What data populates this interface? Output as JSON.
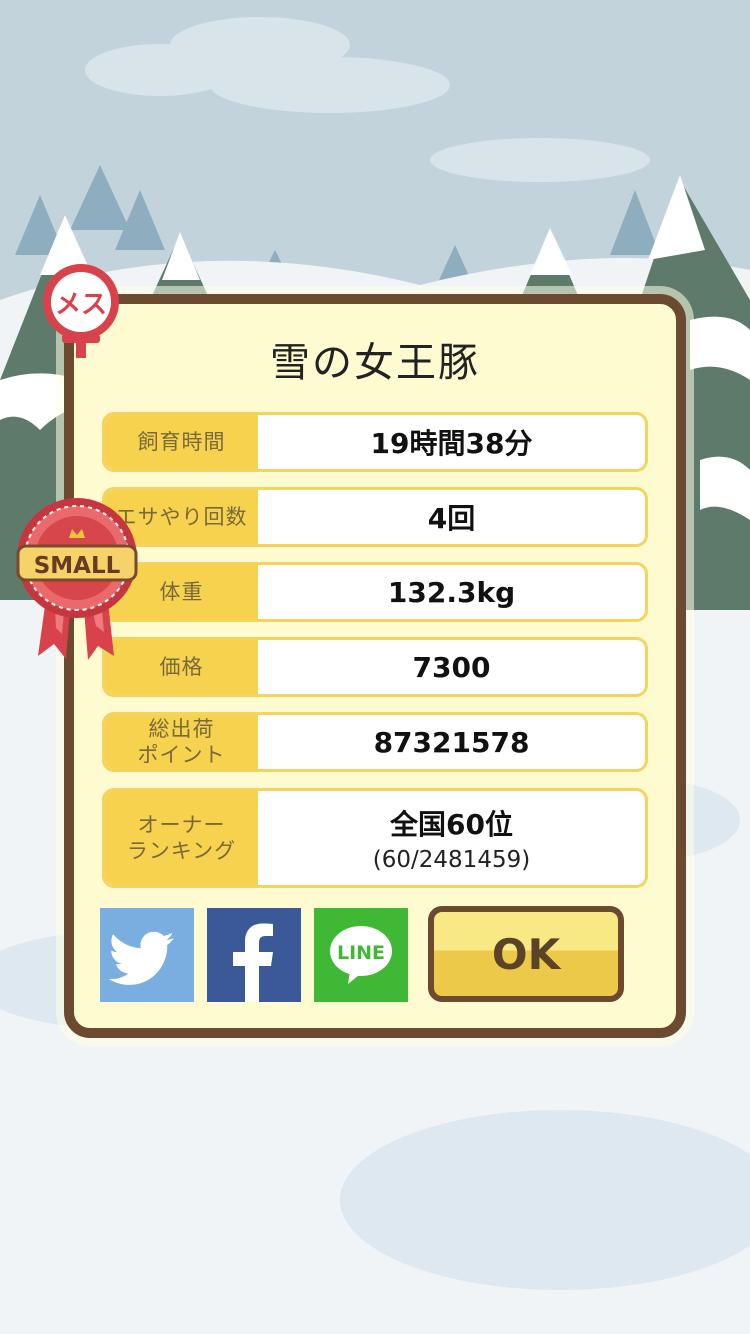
{
  "pig": {
    "name": "雪の女王豚",
    "gender_label": "メス",
    "size_badge": "SMALL"
  },
  "stats": [
    {
      "label": "飼育時間",
      "value": "19時間38分"
    },
    {
      "label": "エサやり回数",
      "value": "4回"
    },
    {
      "label": "体重",
      "value": "132.3kg"
    },
    {
      "label": "価格",
      "value": "7300"
    },
    {
      "label": "総出荷\nポイント",
      "value": "87321578"
    },
    {
      "label": "オーナー\nランキング",
      "value": "全国60位",
      "sub": "(60/2481459)"
    }
  ],
  "share": {
    "line_label": "LINE"
  },
  "actions": {
    "ok_label": "OK"
  },
  "colors": {
    "dialog_bg": "#fffbd0",
    "border": "#6b4a2f",
    "label_bg": "#f6d24e",
    "twitter": "#7aaee0",
    "facebook": "#3b5998",
    "line": "#3fb935",
    "gender": "#d8424a"
  }
}
